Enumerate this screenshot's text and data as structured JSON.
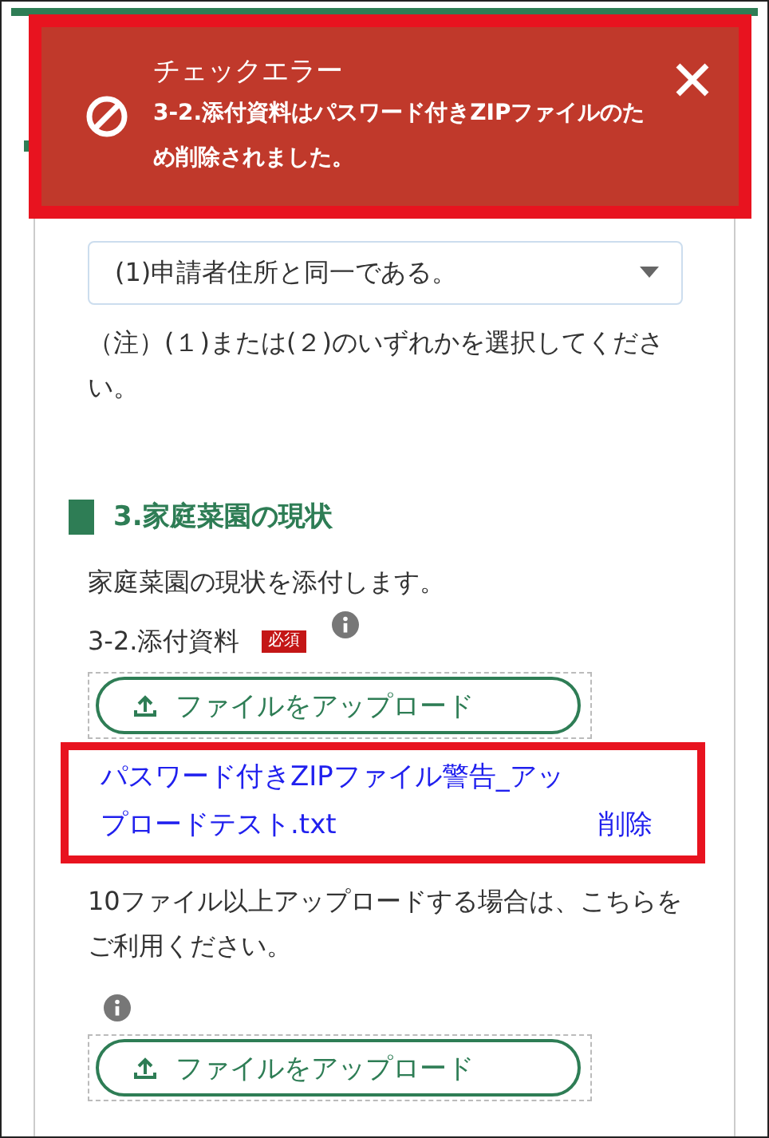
{
  "toast": {
    "title": "チェックエラー",
    "message": "3-2.添付資料はパスワード付きZIPファイルのため削除されました。"
  },
  "select": {
    "value": "(1)申請者住所と同一である。"
  },
  "note": "（注）(１)または(２)のいずれかを選択してください。",
  "section": {
    "heading": "3.家庭菜園の現状",
    "description": "家庭菜園の現状を添付します。"
  },
  "field": {
    "label": "3-2.添付資料",
    "required": "必須",
    "upload_button": "ファイルをアップロード"
  },
  "file": {
    "name": "パスワード付きZIPファイル警告_アップロードテスト.txt",
    "delete": "削除"
  },
  "bulk": {
    "text": "10ファイル以上アップロードする場合は、こちらをご利用ください。",
    "upload_button": "ファイルをアップロード"
  }
}
